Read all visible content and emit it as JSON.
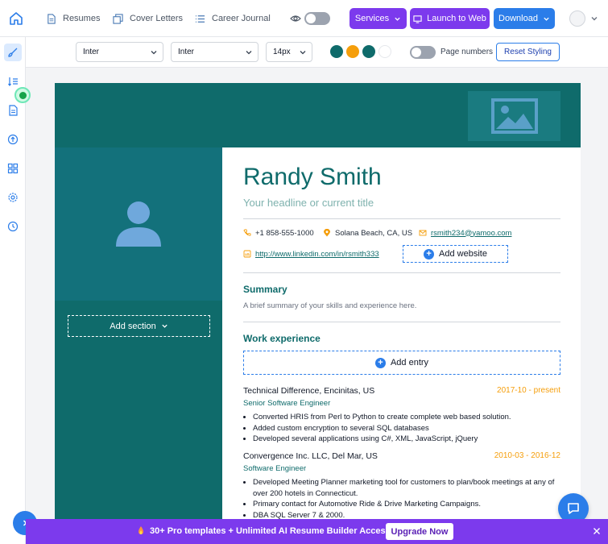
{
  "nav": {
    "links": [
      "Resumes",
      "Cover Letters",
      "Career Journal"
    ],
    "services_label": "Services",
    "launch_label": "Launch to Web",
    "download_label": "Download"
  },
  "toolbar": {
    "font_heading": "Inter",
    "font_body": "Inter",
    "font_size": "14px",
    "swatches": [
      "#0f6b6b",
      "#f59e0b",
      "#0f6b6b",
      "#ffffff"
    ],
    "page_numbers_label": "Page numbers",
    "reset_label": "Reset Styling"
  },
  "resume": {
    "name": "Randy Smith",
    "headline": "Your headline or current title",
    "phone": "+1 858-555-1000",
    "location": "Solana Beach, CA, US",
    "email": "rsmith234@yamoo.com",
    "linkedin": "http://www.linkedin.com/in/rsmith333",
    "add_website": "Add website",
    "add_section": "Add section",
    "summary_title": "Summary",
    "summary_text": "A brief summary of your skills and experience here.",
    "work_title": "Work experience",
    "add_entry": "Add entry",
    "jobs": [
      {
        "company": "Technical Difference, Encinitas, US",
        "dates": "2017-10 - present",
        "title": "Senior Software Engineer",
        "bullets": [
          "Converted HRIS from Perl to Python to create complete web based solution.",
          "Added custom encryption to several SQL databases",
          "Developed several applications using C#, XML, JavaScript, jQuery"
        ]
      },
      {
        "company": "Convergence Inc. LLC, Del Mar, US",
        "dates": "2010-03 - 2016-12",
        "title": "Software Engineer",
        "bullets": [
          "Developed Meeting Planner marketing tool for customers to plan/book meetings at any of",
          "over 200 hotels in Connecticut.",
          "Primary contact for Automotive Ride & Drive Marketing Campaigns.",
          "DBA SQL Server 7 & 2000."
        ]
      }
    ]
  },
  "banner": {
    "text": "30+ Pro templates + Unlimited AI Resume Builder Access",
    "upgrade_label": "Upgrade Now"
  }
}
